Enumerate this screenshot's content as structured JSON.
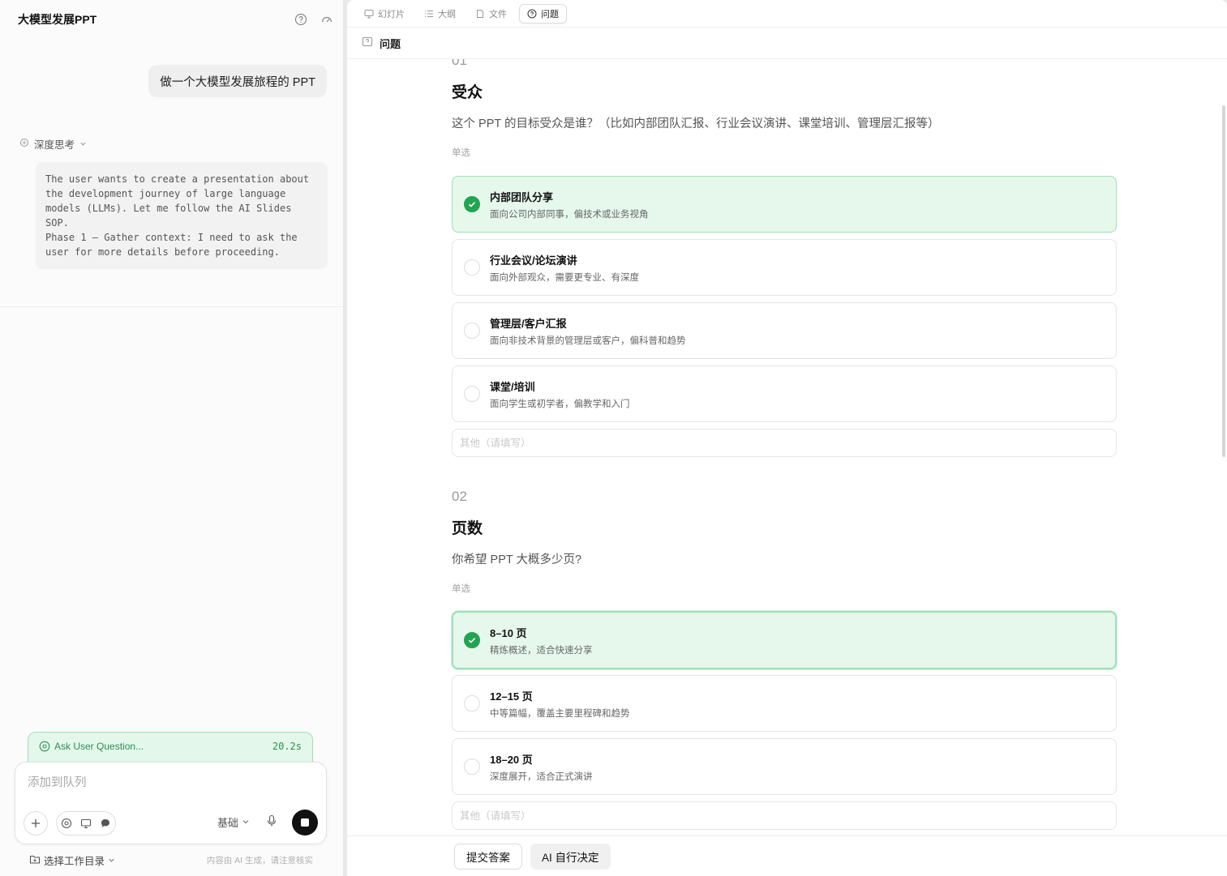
{
  "left": {
    "title": "大模型发展PPT",
    "user_message": "做一个大模型发展旅程的 PPT",
    "thinking_label": "深度思考",
    "thinking_text": "The user wants to create a presentation about\nthe development journey of large language\nmodels (LLMs). Let me follow the AI Slides\nSOP.\nPhase 1 — Gather context: I need to ask the\nuser for more details before proceeding.",
    "status": {
      "label": "Ask User Question...",
      "time": "20.2s"
    },
    "composer": {
      "placeholder": "添加到队列",
      "mode": "基础"
    },
    "workdir_label": "选择工作目录",
    "disclaimer": "内容由 AI 生成，请注意核实"
  },
  "right": {
    "tabs": [
      {
        "label": "幻灯片",
        "icon": "slides-icon"
      },
      {
        "label": "大纲",
        "icon": "outline-icon"
      },
      {
        "label": "文件",
        "icon": "file-icon"
      },
      {
        "label": "问题",
        "icon": "question-icon"
      }
    ],
    "active_tab": "问题",
    "section_title": "问题",
    "questions": [
      {
        "num": "01",
        "title": "受众",
        "text": "这个 PPT 的目标受众是谁？（比如内部团队汇报、行业会议演讲、课堂培训、管理层汇报等）",
        "type": "单选",
        "options": [
          {
            "label": "内部团队分享",
            "desc": "面向公司内部同事，偏技术或业务视角",
            "selected": true
          },
          {
            "label": "行业会议/论坛演讲",
            "desc": "面向外部观众，需要更专业、有深度",
            "selected": false
          },
          {
            "label": "管理层/客户汇报",
            "desc": "面向非技术背景的管理层或客户，偏科普和趋势",
            "selected": false
          },
          {
            "label": "课堂/培训",
            "desc": "面向学生或初学者，偏教学和入门",
            "selected": false
          }
        ],
        "other_placeholder": "其他（请填写）"
      },
      {
        "num": "02",
        "title": "页数",
        "text": "你希望 PPT 大概多少页?",
        "type": "单选",
        "options": [
          {
            "label": "8–10 页",
            "desc": "精炼概述，适合快速分享",
            "selected": true
          },
          {
            "label": "12–15 页",
            "desc": "中等篇幅，覆盖主要里程碑和趋势",
            "selected": false
          },
          {
            "label": "18–20 页",
            "desc": "深度展开，适合正式演讲",
            "selected": false
          }
        ],
        "other_placeholder": "其他（请填写）"
      }
    ],
    "actions": {
      "submit": "提交答案",
      "ai_decide": "AI 自行决定"
    }
  },
  "colors": {
    "accent_green": "#22a552",
    "selected_bg": "#e6f8ec",
    "selected_border": "#9fe0b6"
  }
}
